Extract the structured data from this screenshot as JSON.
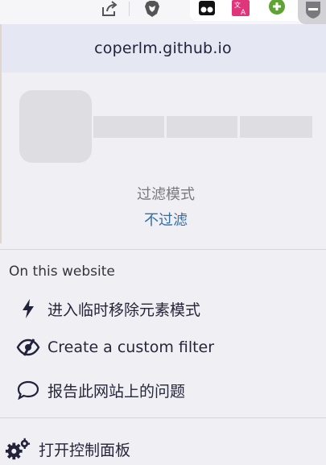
{
  "toolbar": {
    "icons": [
      "share-icon",
      "brave-shield-icon",
      "extension-tampermonkey-icon",
      "extension-translate-icon",
      "extension-add-icon",
      "ublock-icon"
    ]
  },
  "header": {
    "domain": "coperlm.github.io"
  },
  "filter_mode": {
    "label": "过滤模式",
    "value": "不过滤"
  },
  "section": {
    "title": "On this website"
  },
  "menu": {
    "items": [
      {
        "icon": "lightning-icon",
        "label": "进入临时移除元素模式"
      },
      {
        "icon": "eye-slash-icon",
        "label": "Create a custom filter"
      },
      {
        "icon": "speech-bubble-icon",
        "label": "报告此网站上的问题"
      }
    ],
    "dashboard": {
      "icon": "gears-icon",
      "label": "打开控制面板"
    }
  },
  "colors": {
    "header_bg": "#e5e7f2",
    "panel_bg": "#f0eff3",
    "link": "#2f6ea8"
  }
}
